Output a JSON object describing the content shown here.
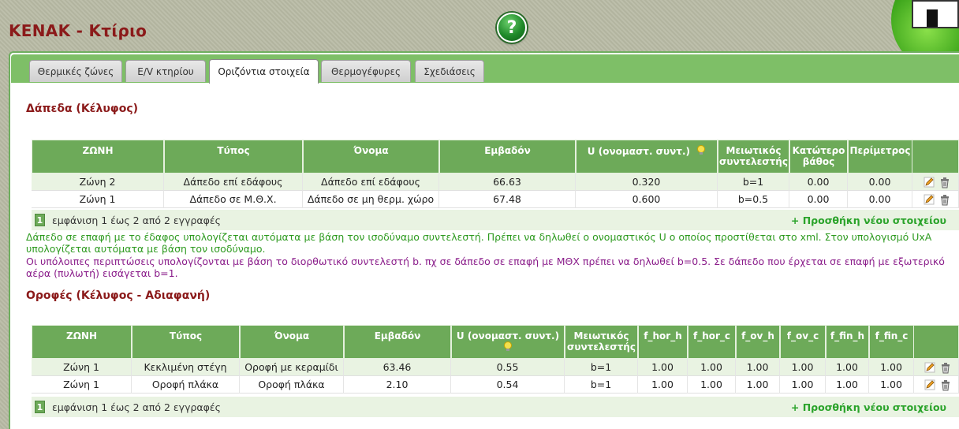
{
  "app": {
    "title": "KENAK - Κτίριο",
    "help_label": "?"
  },
  "tabs": [
    {
      "label": "Θερμικές ζώνες"
    },
    {
      "label": "Ε/V κτηρίου"
    },
    {
      "label": "Οριζόντια στοιχεία",
      "active": true
    },
    {
      "label": "Θερμογέφυρες"
    },
    {
      "label": "Σχεδιάσεις"
    }
  ],
  "floors": {
    "title": "Δάπεδα (Κέλυφος)",
    "headers": [
      "ΖΩΝΗ",
      "Τύπος",
      "Όνομα",
      "Εμβαδόν",
      "U (ονομαστ. συντ.)",
      "Μειωτικός συντελεστής",
      "Κατώτερο βάθος",
      "Περίμετρος"
    ],
    "rows": [
      [
        "Ζώνη 2",
        "Δάπεδο επί εδάφους",
        "Δάπεδο επί εδάφους",
        "66.63",
        "0.320",
        "b=1",
        "0.00",
        "0.00"
      ],
      [
        "Ζώνη 1",
        "Δάπεδο σε Μ.Θ.Χ.",
        "Δάπεδο σε μη θερμ. χώρο",
        "67.48",
        "0.600",
        "b=0.5",
        "0.00",
        "0.00"
      ]
    ],
    "page": "1",
    "pager_text": "εμφάνιση 1 έως 2 από 2 εγγραφές",
    "add_label": "+ Προσθήκη νέου στοιχείου"
  },
  "notes": {
    "green": "Δάπεδο σε επαφή με το έδαφος υπολογίζεται αυτόματα με βάση τον ισοδύναμο συντελεστή. Πρέπει να δηλωθεί ο ονομαστικός U ο οποίος προστίθεται στο xml. Στον υπολογισμό UxA υπολογίζεται αυτόματα με βάση τον ισοδύναμο.",
    "purple": "Οι υπόλοιπες περιπτώσεις υπολογίζονται με βάση το διορθωτικό συντελεστή b. πχ σε δάπεδο σε επαφή με ΜΘΧ πρέπει να δηλωθεί b=0.5. Σε δάπεδο που έρχεται σε επαφή με εξωτερικό αέρα (πυλωτή) εισάγεται b=1."
  },
  "roofs": {
    "title": "Οροφές (Κέλυφος - Αδιαφανή)",
    "headers": [
      "ΖΩΝΗ",
      "Τύπος",
      "Όνομα",
      "Εμβαδόν",
      "U (ονομαστ. συντ.)",
      "Μειωτικός συντελεστής",
      "f_hor_h",
      "f_hor_c",
      "f_ov_h",
      "f_ov_c",
      "f_fin_h",
      "f_fin_c"
    ],
    "rows": [
      [
        "Ζώνη 1",
        "Κεκλιμένη στέγη",
        "Οροφή με κεραμίδι",
        "63.46",
        "0.55",
        "b=1",
        "1.00",
        "1.00",
        "1.00",
        "1.00",
        "1.00",
        "1.00"
      ],
      [
        "Ζώνη 1",
        "Οροφή πλάκα",
        "Οροφή πλάκα",
        "2.10",
        "0.54",
        "b=1",
        "1.00",
        "1.00",
        "1.00",
        "1.00",
        "1.00",
        "1.00"
      ]
    ],
    "page": "1",
    "pager_text": "εμφάνιση 1 έως 2 από 2 εγγραφές",
    "add_label": "+ Προσθήκη νέου στοιχείου"
  },
  "icons": {
    "edit": "pencil-icon",
    "delete": "trash-icon",
    "hint": "lightbulb-icon",
    "help": "question-icon"
  },
  "colors": {
    "accent_green": "#6daa59",
    "title_red": "#8b1a1a",
    "add_link": "#2aa32a"
  }
}
